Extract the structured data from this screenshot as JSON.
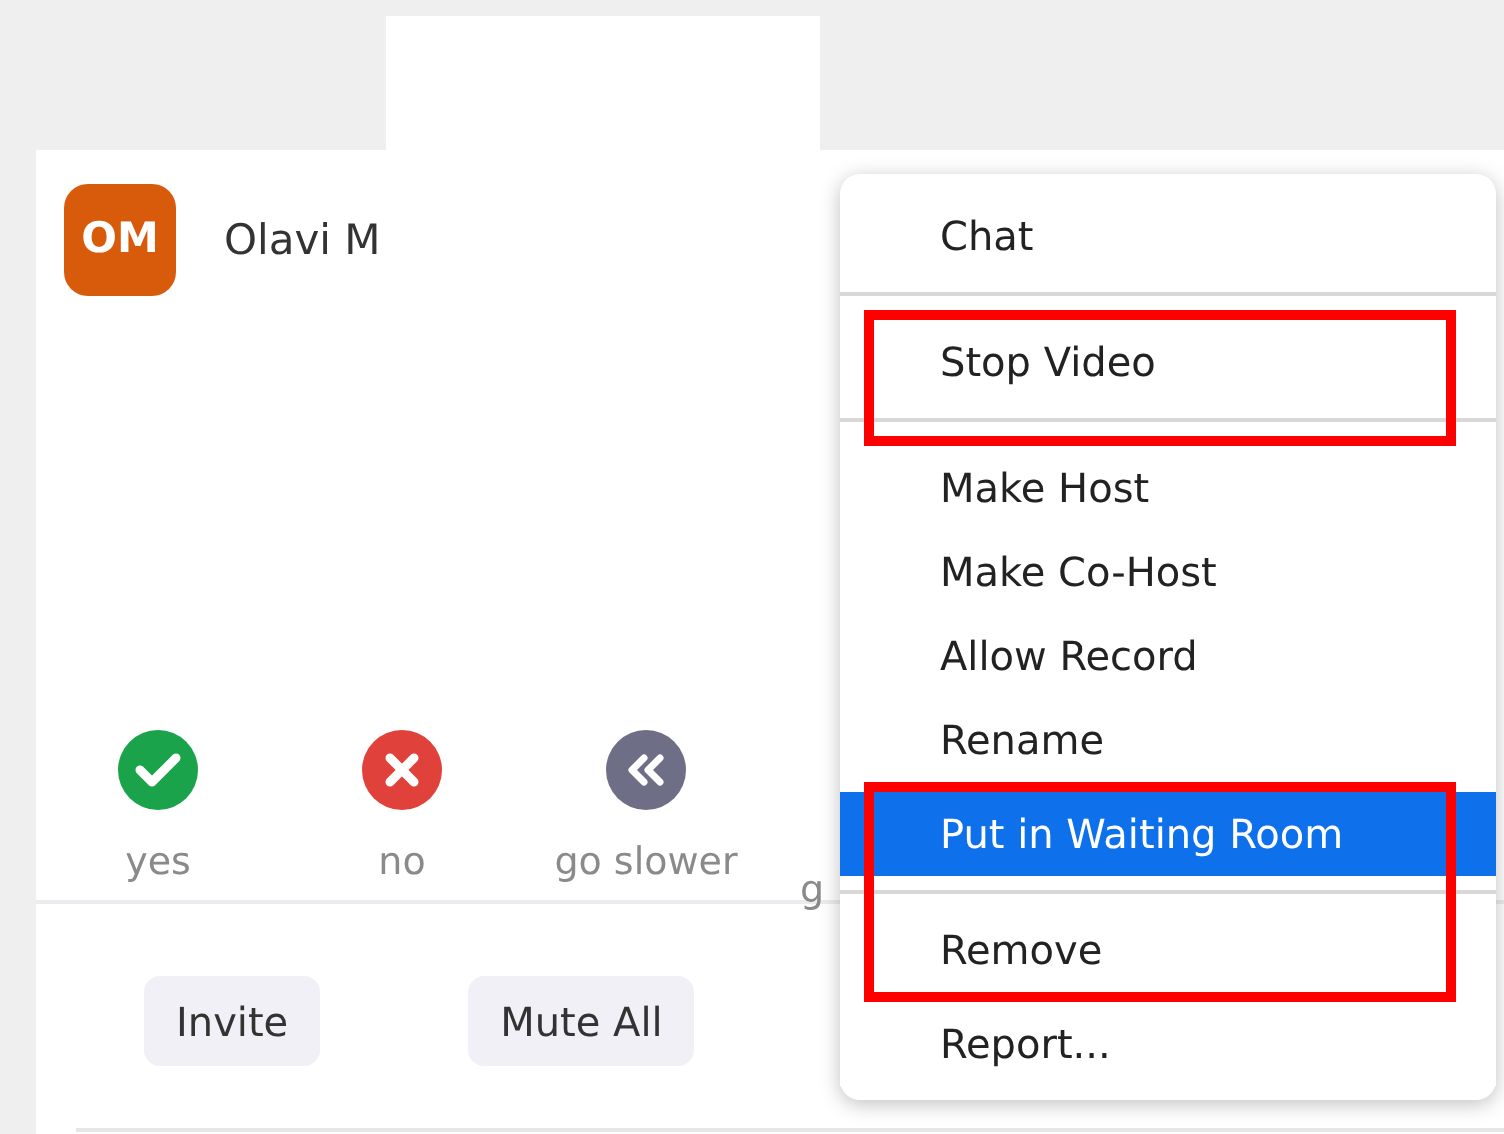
{
  "participant": {
    "initials": "OM",
    "name": "Olavi M"
  },
  "reactions": [
    {
      "kind": "check",
      "label": "yes"
    },
    {
      "kind": "cross",
      "label": "no"
    },
    {
      "kind": "rewind",
      "label": "go slower"
    },
    {
      "kind": "hidden",
      "label": "g"
    }
  ],
  "buttons": [
    "Invite",
    "Mute All"
  ],
  "menu": {
    "sections": [
      [
        {
          "label": "Chat",
          "selected": false,
          "annotated": false
        }
      ],
      [
        {
          "label": "Stop Video",
          "selected": false,
          "annotated": true
        }
      ],
      [
        {
          "label": "Make Host",
          "selected": false,
          "annotated": false
        },
        {
          "label": "Make Co-Host",
          "selected": false,
          "annotated": false
        },
        {
          "label": "Allow Record",
          "selected": false,
          "annotated": false
        },
        {
          "label": "Rename",
          "selected": false,
          "annotated": false
        },
        {
          "label": "Put in Waiting Room",
          "selected": true,
          "annotated": true
        }
      ],
      [
        {
          "label": "Remove",
          "selected": false,
          "annotated": true
        },
        {
          "label": "Report...",
          "selected": false,
          "annotated": false
        }
      ]
    ]
  }
}
